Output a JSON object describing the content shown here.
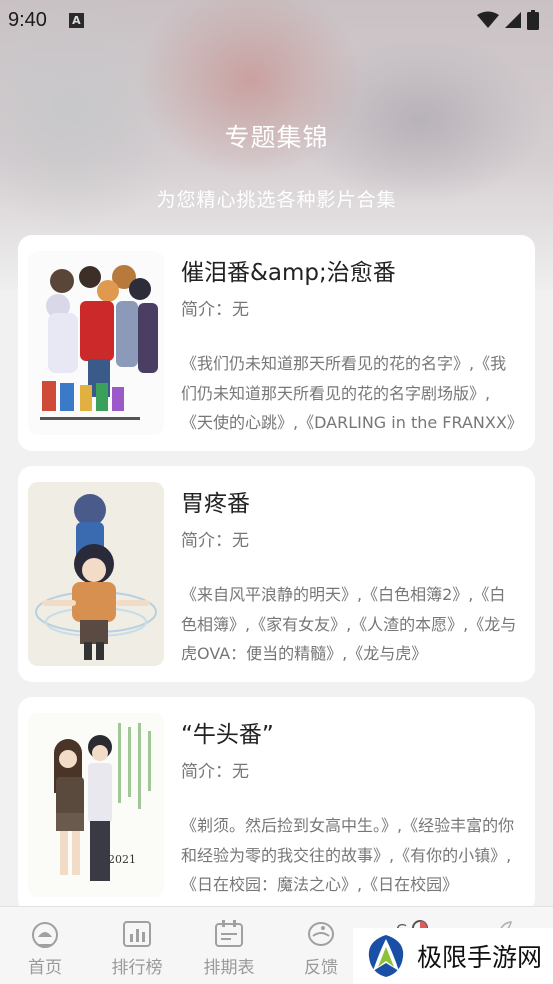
{
  "status_bar": {
    "time": "9:40",
    "notification_icon_letter": "A",
    "icons": [
      "wifi-icon",
      "signal-icon",
      "battery-icon"
    ]
  },
  "header": {
    "title": "专题集锦",
    "subtitle": "为您精心挑选各种影片合集"
  },
  "collections": [
    {
      "title": "催泪番&amp;治愈番",
      "intro": "简介：无",
      "description": "《我们仍未知道那天所看见的花的名字》,《我们仍未知道那天所看见的花的名字剧场版》,《天使的心跳》,《DARLING in the FRANXX》"
    },
    {
      "title": "胃疼番",
      "intro": "简介：无",
      "description": "《来自风平浪静的明天》,《白色相簿2》,《白色相簿》,《家有女友》,《人渣的本愿》,《龙与虎OVA：便当的精髓》,《龙与虎》"
    },
    {
      "title": "“牛头番”",
      "intro": "简介：无",
      "description": "《剃须。然后捡到女高中生。》,《经验丰富的你和经验为零的我交往的故事》,《有你的小镇》,《日在校园：魔法之心》,《日在校园》"
    }
  ],
  "tabbar": {
    "tabs": [
      {
        "label": "首页",
        "icon": "home-icon"
      },
      {
        "label": "排行榜",
        "icon": "ranking-icon"
      },
      {
        "label": "排期表",
        "icon": "calendar-icon"
      },
      {
        "label": "反馈",
        "icon": "feedback-icon"
      },
      {
        "label": "",
        "icon": "collection-icon"
      },
      {
        "label": "",
        "icon": "profile-icon"
      }
    ]
  },
  "watermark": {
    "text": "极限手游网"
  },
  "colors": {
    "background": "#f1f1f1",
    "card": "#ffffff",
    "text_primary": "#222222",
    "text_secondary": "#777777",
    "tab_inactive": "#9a9a9a",
    "accent": "#e05a5a"
  }
}
